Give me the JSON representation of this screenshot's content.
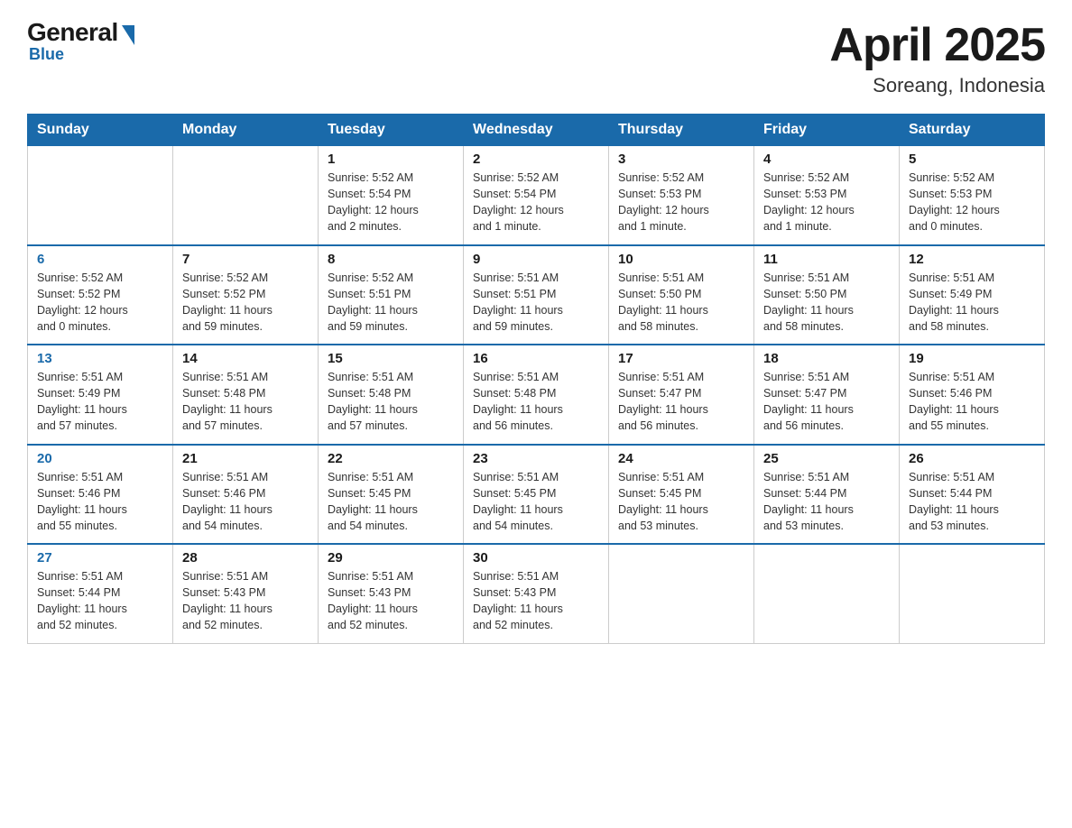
{
  "logo": {
    "general": "General",
    "blue": "Blue"
  },
  "title": "April 2025",
  "location": "Soreang, Indonesia",
  "days_of_week": [
    "Sunday",
    "Monday",
    "Tuesday",
    "Wednesday",
    "Thursday",
    "Friday",
    "Saturday"
  ],
  "weeks": [
    [
      {
        "day": "",
        "info": ""
      },
      {
        "day": "",
        "info": ""
      },
      {
        "day": "1",
        "info": "Sunrise: 5:52 AM\nSunset: 5:54 PM\nDaylight: 12 hours\nand 2 minutes."
      },
      {
        "day": "2",
        "info": "Sunrise: 5:52 AM\nSunset: 5:54 PM\nDaylight: 12 hours\nand 1 minute."
      },
      {
        "day": "3",
        "info": "Sunrise: 5:52 AM\nSunset: 5:53 PM\nDaylight: 12 hours\nand 1 minute."
      },
      {
        "day": "4",
        "info": "Sunrise: 5:52 AM\nSunset: 5:53 PM\nDaylight: 12 hours\nand 1 minute."
      },
      {
        "day": "5",
        "info": "Sunrise: 5:52 AM\nSunset: 5:53 PM\nDaylight: 12 hours\nand 0 minutes."
      }
    ],
    [
      {
        "day": "6",
        "info": "Sunrise: 5:52 AM\nSunset: 5:52 PM\nDaylight: 12 hours\nand 0 minutes."
      },
      {
        "day": "7",
        "info": "Sunrise: 5:52 AM\nSunset: 5:52 PM\nDaylight: 11 hours\nand 59 minutes."
      },
      {
        "day": "8",
        "info": "Sunrise: 5:52 AM\nSunset: 5:51 PM\nDaylight: 11 hours\nand 59 minutes."
      },
      {
        "day": "9",
        "info": "Sunrise: 5:51 AM\nSunset: 5:51 PM\nDaylight: 11 hours\nand 59 minutes."
      },
      {
        "day": "10",
        "info": "Sunrise: 5:51 AM\nSunset: 5:50 PM\nDaylight: 11 hours\nand 58 minutes."
      },
      {
        "day": "11",
        "info": "Sunrise: 5:51 AM\nSunset: 5:50 PM\nDaylight: 11 hours\nand 58 minutes."
      },
      {
        "day": "12",
        "info": "Sunrise: 5:51 AM\nSunset: 5:49 PM\nDaylight: 11 hours\nand 58 minutes."
      }
    ],
    [
      {
        "day": "13",
        "info": "Sunrise: 5:51 AM\nSunset: 5:49 PM\nDaylight: 11 hours\nand 57 minutes."
      },
      {
        "day": "14",
        "info": "Sunrise: 5:51 AM\nSunset: 5:48 PM\nDaylight: 11 hours\nand 57 minutes."
      },
      {
        "day": "15",
        "info": "Sunrise: 5:51 AM\nSunset: 5:48 PM\nDaylight: 11 hours\nand 57 minutes."
      },
      {
        "day": "16",
        "info": "Sunrise: 5:51 AM\nSunset: 5:48 PM\nDaylight: 11 hours\nand 56 minutes."
      },
      {
        "day": "17",
        "info": "Sunrise: 5:51 AM\nSunset: 5:47 PM\nDaylight: 11 hours\nand 56 minutes."
      },
      {
        "day": "18",
        "info": "Sunrise: 5:51 AM\nSunset: 5:47 PM\nDaylight: 11 hours\nand 56 minutes."
      },
      {
        "day": "19",
        "info": "Sunrise: 5:51 AM\nSunset: 5:46 PM\nDaylight: 11 hours\nand 55 minutes."
      }
    ],
    [
      {
        "day": "20",
        "info": "Sunrise: 5:51 AM\nSunset: 5:46 PM\nDaylight: 11 hours\nand 55 minutes."
      },
      {
        "day": "21",
        "info": "Sunrise: 5:51 AM\nSunset: 5:46 PM\nDaylight: 11 hours\nand 54 minutes."
      },
      {
        "day": "22",
        "info": "Sunrise: 5:51 AM\nSunset: 5:45 PM\nDaylight: 11 hours\nand 54 minutes."
      },
      {
        "day": "23",
        "info": "Sunrise: 5:51 AM\nSunset: 5:45 PM\nDaylight: 11 hours\nand 54 minutes."
      },
      {
        "day": "24",
        "info": "Sunrise: 5:51 AM\nSunset: 5:45 PM\nDaylight: 11 hours\nand 53 minutes."
      },
      {
        "day": "25",
        "info": "Sunrise: 5:51 AM\nSunset: 5:44 PM\nDaylight: 11 hours\nand 53 minutes."
      },
      {
        "day": "26",
        "info": "Sunrise: 5:51 AM\nSunset: 5:44 PM\nDaylight: 11 hours\nand 53 minutes."
      }
    ],
    [
      {
        "day": "27",
        "info": "Sunrise: 5:51 AM\nSunset: 5:44 PM\nDaylight: 11 hours\nand 52 minutes."
      },
      {
        "day": "28",
        "info": "Sunrise: 5:51 AM\nSunset: 5:43 PM\nDaylight: 11 hours\nand 52 minutes."
      },
      {
        "day": "29",
        "info": "Sunrise: 5:51 AM\nSunset: 5:43 PM\nDaylight: 11 hours\nand 52 minutes."
      },
      {
        "day": "30",
        "info": "Sunrise: 5:51 AM\nSunset: 5:43 PM\nDaylight: 11 hours\nand 52 minutes."
      },
      {
        "day": "",
        "info": ""
      },
      {
        "day": "",
        "info": ""
      },
      {
        "day": "",
        "info": ""
      }
    ]
  ]
}
